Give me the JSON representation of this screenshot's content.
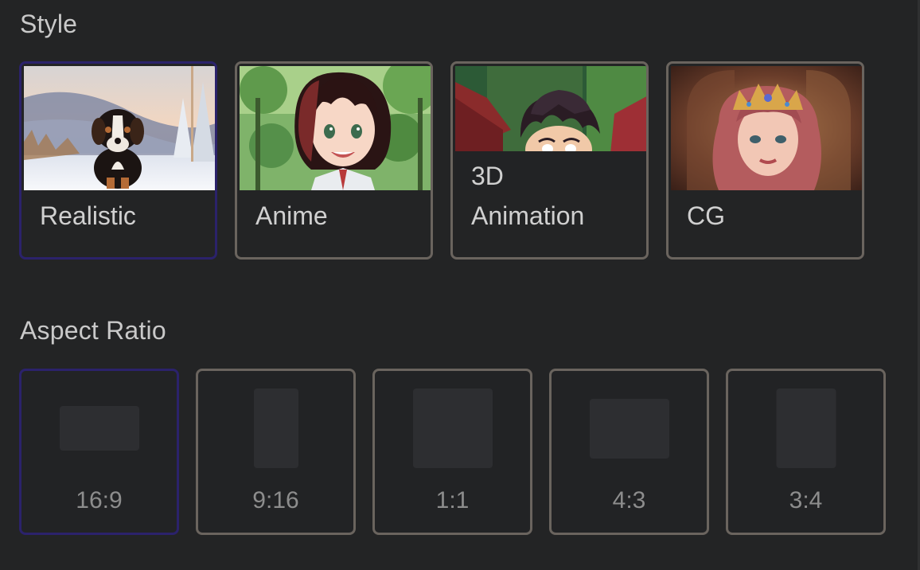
{
  "style_section": {
    "title": "Style",
    "options": [
      {
        "label": "Realistic",
        "selected": true,
        "thumbnail": "bernese-puppy-in-snow"
      },
      {
        "label": "Anime",
        "selected": false,
        "thumbnail": "anime-girl-in-forest"
      },
      {
        "label": "3D\nAnimation",
        "selected": false,
        "thumbnail": "3d-cartoon-boy"
      },
      {
        "label": "CG",
        "selected": false,
        "thumbnail": "cg-princess-with-crown"
      }
    ]
  },
  "aspect_section": {
    "title": "Aspect Ratio",
    "options": [
      {
        "label": "16:9",
        "selected": true
      },
      {
        "label": "9:16",
        "selected": false
      },
      {
        "label": "1:1",
        "selected": false
      },
      {
        "label": "4:3",
        "selected": false
      },
      {
        "label": "3:4",
        "selected": false
      }
    ]
  },
  "colors": {
    "background": "#232425",
    "card_border": "#6a645e",
    "selected_border": "#2b226b",
    "text": "#d0d0d0",
    "muted_text": "#8d8d8d"
  }
}
